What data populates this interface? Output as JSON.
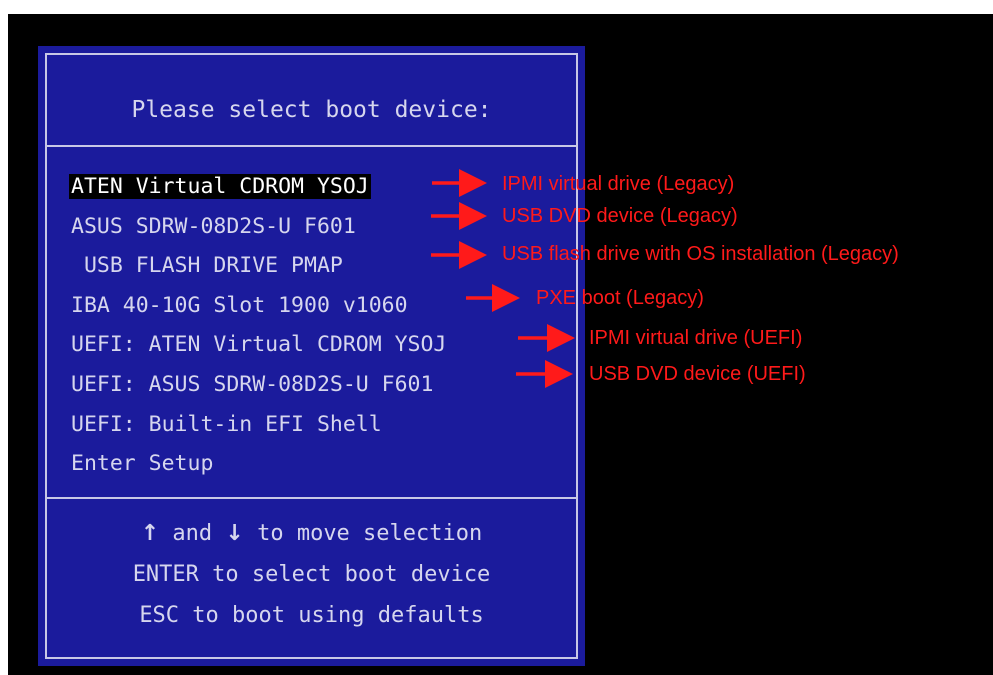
{
  "boot_menu": {
    "title": "Please select boot device:",
    "devices": [
      {
        "label": "ATEN Virtual CDROM YSOJ",
        "selected": true
      },
      {
        "label": "ASUS SDRW-08D2S-U F601",
        "selected": false
      },
      {
        "label": " USB FLASH DRIVE PMAP",
        "selected": false
      },
      {
        "label": "IBA 40-10G Slot 1900 v1060",
        "selected": false
      },
      {
        "label": "UEFI: ATEN Virtual CDROM YSOJ",
        "selected": false
      },
      {
        "label": "UEFI: ASUS SDRW-08D2S-U F601",
        "selected": false
      },
      {
        "label": "UEFI: Built-in EFI Shell",
        "selected": false
      },
      {
        "label": "Enter Setup",
        "selected": false
      }
    ],
    "help": {
      "up_arrow": "↑",
      "and_text": " and ",
      "down_arrow": "↓",
      "move_text": " to move selection",
      "enter_line": "ENTER to select boot device",
      "esc_line": "ESC to boot using defaults"
    }
  },
  "annotations": [
    {
      "text": "IPMI virtual drive (Legacy)"
    },
    {
      "text": "USB DVD device (Legacy)"
    },
    {
      "text": "USB flash drive with OS installation (Legacy)"
    },
    {
      "text": "PXE boot (Legacy)"
    },
    {
      "text": "IPMI virtual drive (UEFI)"
    },
    {
      "text": "USB DVD device (UEFI)"
    }
  ],
  "colors": {
    "menu_background": "#1b1b9c",
    "menu_text": "#d6d6ee",
    "annotation": "#ff1a1a",
    "screen_background": "#000000"
  }
}
